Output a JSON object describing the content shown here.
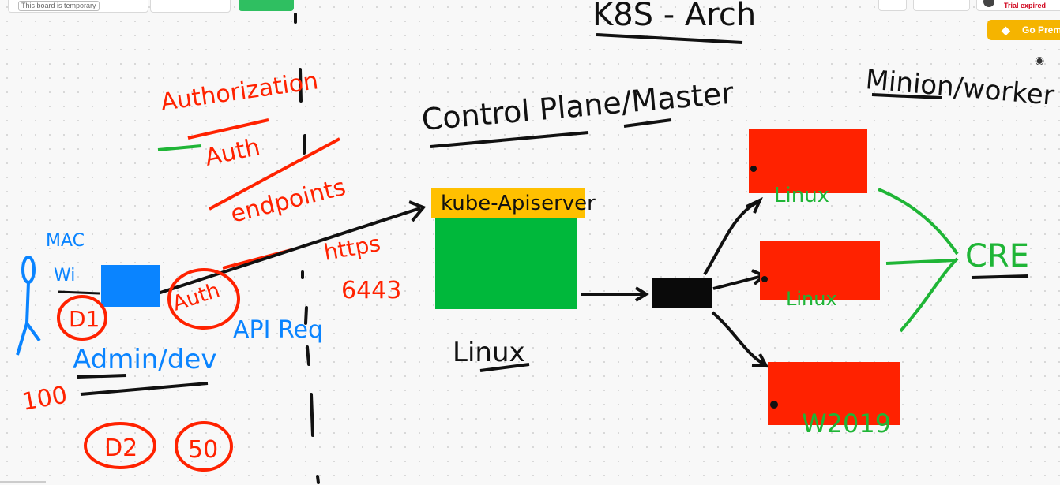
{
  "header": {
    "board_badge": "This board is temporary",
    "trial_text": "Trial expired",
    "premium_label": "Go Premi",
    "eye_icon": "eye-icon",
    "gem_icon": "gem-icon"
  },
  "colors": {
    "red": "#ff2200",
    "blue": "#0a84ff",
    "green": "#00b83b",
    "yellow": "#ffc000",
    "black": "#0a0a0a",
    "handwriting_green": "#1fb536"
  },
  "diagram": {
    "title": "K8S - Arch",
    "control_plane": "Control Plane/Master",
    "apiserver": "kube-Apiserver",
    "control_os": "Linux",
    "workers_title": "Minion/worker",
    "worker_os": [
      "Linux",
      "Linux",
      "W2019"
    ],
    "cre": "CRE",
    "authorization": "Authorization",
    "auth": "Auth",
    "endpoints": "endpoints",
    "https": "https",
    "port": "6443",
    "mac": "MAC",
    "win": "Wi",
    "d1": "D1",
    "d2": "D2",
    "d50": "50",
    "count": "100",
    "api_req": "API Req",
    "admin": "Admin/dev",
    "auth_circle": "Auth"
  }
}
